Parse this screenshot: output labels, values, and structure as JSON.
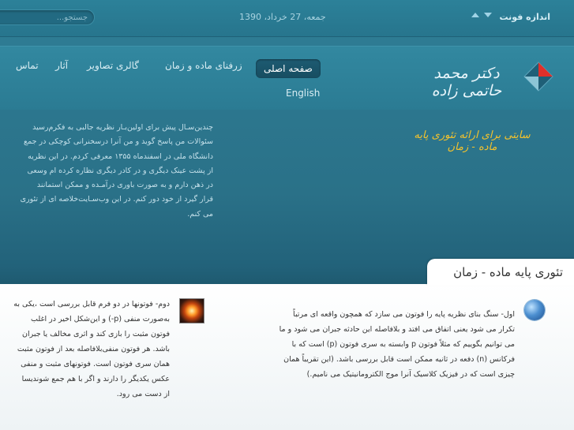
{
  "header": {
    "font_size_label": "اندازه فونت",
    "date": "جمعه، 27 خرداد، 1390",
    "search_placeholder": "جستجو..."
  },
  "site": {
    "name": "دکتر محمد حاتمی زاده",
    "tagline": "سایتی برای ارائه تئوری پایه ماده - زمان"
  },
  "nav": {
    "items": [
      {
        "label": "صفحه اصلی",
        "active": true
      },
      {
        "label": "زرفنای ماده و زمان",
        "active": false
      },
      {
        "label": "گالری تصاویر",
        "active": false
      },
      {
        "label": "آثار",
        "active": false
      },
      {
        "label": "تماس",
        "active": false
      }
    ],
    "english": "English"
  },
  "intro": {
    "lines": [
      "چندین‌سـال پیش برای اولین‌بـار نظریه جالبی به فکرم‌رسید",
      "سئوالات من پاسخ گوید و من آنرا درسخنرانی کوچکی در جمع",
      "دانشگاه ملی در اسفندماه ۱۳۵۵ معرفی کردم. در این نظریه",
      "از پشت عینک دیگری و در کادر دیگری نظاره کرده ام وسعی",
      "در ذهن دارم و به صورت باوری درآمـده و ممکن استمانند",
      "قرار گیرد از خود دور کنم. در این وب‌سـایت‌خلاصه ای از تئوری",
      "می کنم."
    ]
  },
  "content": {
    "title": "تئوری پایه ماده - زمان",
    "col1": [
      "اول- سنگ بنای نظریه پایه را فوتون می سازد که همچون واقعه ای مرتباً",
      "تکرار می شود یعنی اتفاق می افتد و بلافاصله این حادثه جبران می شود و ما",
      "می توانیم بگوییم که مثلاً فوتون p وابسته به سری فوتون (p) است که با",
      "فرکانس (n) دفعه در ثانیه ممکن است قابل بررسی باشد. (این تقریباً همان",
      "چیزی است که در فیزیک کلاسیک آنرا موج الکترومانیتیک می نامیم.)"
    ],
    "col2": [
      "دوم- فوتونها در دو فرم قابل بررسی است ،یکی به",
      "به‌صورت منفی (p-) و این‌شکل اخیر در اغلب",
      "فوتون مثبت را بازی کند و اثری مخالف یا جبران",
      "باشد. هر فوتون منفی‌بلافاصله بعد از فوتون مثبت",
      "همان سری فوتون است. فوتونهای مثبت و منفی",
      "عکس یکدیگر را دارند و اگر با هم جمع شوندیسا",
      "از دست می رود."
    ]
  },
  "colors": {
    "accent": "#f6c32b",
    "band": "#2b7b93",
    "logo_red": "#e0302a"
  }
}
